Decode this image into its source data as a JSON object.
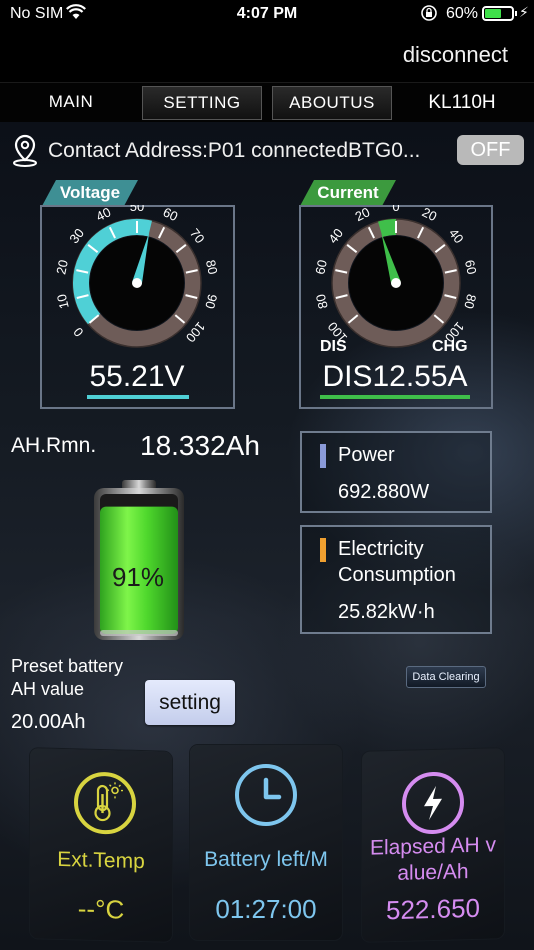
{
  "status_bar": {
    "carrier": "No SIM",
    "time": "4:07 PM",
    "battery_percent": "60%",
    "battery_level": 0.6,
    "icons": [
      "wifi-icon",
      "orientation-lock-icon",
      "battery-icon",
      "charging-bolt-icon"
    ]
  },
  "header": {
    "disconnect_label": "disconnect"
  },
  "tabs": {
    "main": "MAIN",
    "setting": "SETTING",
    "aboutus": "ABOUTUS",
    "model": "KL110H"
  },
  "address": {
    "text": "Contact Address:P01  connectedBTG0...",
    "toggle_label": "OFF",
    "icon": "location-pin-icon"
  },
  "voltage": {
    "tag": "Voltage",
    "value": "55.21V",
    "reading": 55.21,
    "scale_labels": [
      "0",
      "10",
      "20",
      "30",
      "40",
      "50",
      "60",
      "70",
      "80",
      "90",
      "100"
    ],
    "color": "#4fd0d6"
  },
  "current": {
    "tag": "Current",
    "value": "DIS12.55A",
    "reading": -12.55,
    "scale_labels": [
      "100",
      "80",
      "60",
      "40",
      "20",
      "0",
      "20",
      "40",
      "60",
      "80",
      "100"
    ],
    "dis_label": "DIS",
    "chg_label": "CHG",
    "color": "#3fbf4a"
  },
  "remaining": {
    "label": "AH.Rmn.",
    "value": "18.332Ah"
  },
  "power": {
    "title": "Power",
    "value": "692.880W",
    "accent": "#8a9ad8"
  },
  "consumption": {
    "title_line1": "Electricity",
    "title_line2": "Consumption",
    "value": "25.82kW·h",
    "accent": "#f0a030"
  },
  "battery": {
    "percent_text": "91%",
    "level": 0.91
  },
  "preset": {
    "label_line1": "Preset battery",
    "label_line2": "AH value",
    "value": "20.00Ah",
    "setting_label": "setting",
    "clear_label": "Data Clearing"
  },
  "cards": [
    {
      "label": "Ext.Temp",
      "value": "--°C",
      "color": "#d8d440",
      "icon": "thermometer-icon"
    },
    {
      "label": "Battery left/M",
      "value": "01:27:00",
      "color": "#7ec6ee",
      "icon": "clock-icon"
    },
    {
      "label_line1": "Elapsed AH v",
      "label_line2": "alue/Ah",
      "value": "522.650",
      "color": "#d58cf0",
      "icon": "lightning-icon"
    }
  ]
}
